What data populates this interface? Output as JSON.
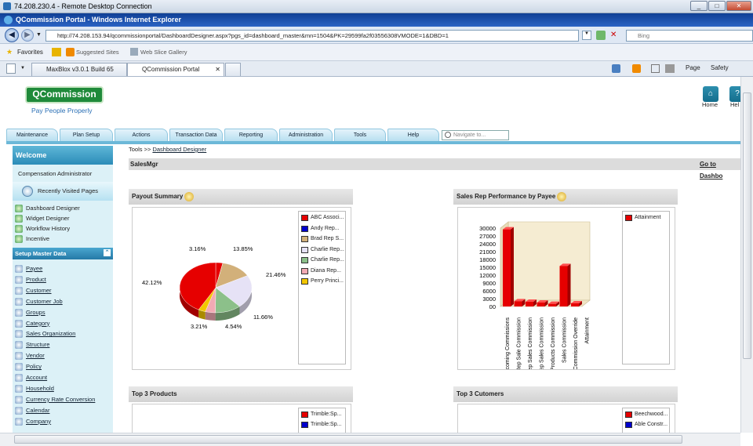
{
  "rdp": {
    "title": "74.208.230.4 - Remote Desktop Connection"
  },
  "ie": {
    "title": "QCommission Portal - Windows Internet Explorer",
    "url": "http://74.208.153.94/qcommissionportal/DashboardDesigner.aspx?pgs_id=dashboard_master&mn=1504&PK=29599fa2f03556308VMODE=1&DBD=1",
    "search_placeholder": "Bing",
    "favorites": "Favorites",
    "suggested": "Suggested Sites",
    "webslice": "Web Slice Gallery",
    "tabs": [
      "MaxBlox v3.0.1 Build 65",
      "QCommission Portal"
    ],
    "cmd_page": "Page",
    "cmd_safety": "Safety"
  },
  "app": {
    "logo": "QCommission",
    "tagline": "Pay People Properly",
    "home": "Home",
    "help": "Hel",
    "nav": [
      "Maintenance",
      "Plan Setup",
      "Actions",
      "Transaction Data",
      "Reporting",
      "Administration",
      "Tools",
      "Help"
    ],
    "navigate_placeholder": "Navigate to..."
  },
  "sidebar": {
    "welcome": "Welcome",
    "role": "Compensation Administrator",
    "recent": "Recently Visited Pages",
    "recent_items": [
      "Dashboard Designer",
      "Widget Designer",
      "Workflow History",
      "Incentive"
    ],
    "setup_title": "Setup Master Data",
    "setup_items": [
      "Payee",
      "Product",
      "Customer",
      "Customer Job",
      "Groups",
      "Category",
      "Sales Organization",
      "Structure",
      "Vendor",
      "Policy",
      "Account",
      "Household",
      "Currency Rate Conversion",
      "Calendar",
      "Company"
    ]
  },
  "content": {
    "crumb_prefix": "Tools >> ",
    "crumb_link": "Dashboard Designer",
    "section": "SalesMgr",
    "goto": "Go to Dashbo"
  },
  "widgets": {
    "payout": "Payout Summary",
    "salesrep": "Sales Rep Performance by Payee",
    "products": "Top 3 Products",
    "customers": "Top 3 Cutomers"
  },
  "pie": {
    "slices": [
      {
        "name": "ABC  Associ...",
        "pct": 3.16,
        "label": "3.16%",
        "color": "#e60000"
      },
      {
        "name": "Andy  Rep...",
        "pct": 0.01,
        "label": "",
        "color": "#0000cc"
      },
      {
        "name": "Brad  Rep S...",
        "pct": 13.85,
        "label": "13.85%",
        "color": "#d2b07a"
      },
      {
        "name": "Charlie  Rep...",
        "pct": 21.46,
        "label": "21.46%",
        "color": "#e6e2f6"
      },
      {
        "name": "Charlie  Rep...",
        "pct": 11.66,
        "label": "11.66%",
        "color": "#8cc08a"
      },
      {
        "name": "Diana  Rep...",
        "pct": 4.54,
        "label": "4.54%",
        "color": "#f2aab4"
      },
      {
        "name": "Perry  Princi...",
        "pct": 3.21,
        "label": "3.21%",
        "color": "#f2c600"
      },
      {
        "name": "ABC  Associ...",
        "pct": 42.12,
        "label": "42.12%",
        "color": "#e60000"
      }
    ]
  },
  "chart_data": {
    "type": "bar",
    "title": "Sales Rep Performance by Payee",
    "categories": [
      "Incoming Commissions",
      "Rep Sale Commission",
      "Rep Sales Commission",
      "Rep Sales Commission",
      "Products Commission",
      "Sales Commission",
      "Commission Override",
      "Attainment"
    ],
    "series": [
      {
        "name": "Attainment",
        "values": [
          29500,
          2000,
          1800,
          1500,
          1000,
          15500,
          1200,
          0
        ],
        "color": "#e60000"
      }
    ],
    "yticks": [
      "30000",
      "27000",
      "24000",
      "21000",
      "18000",
      "15000",
      "12000",
      "9000",
      "6000",
      "3000",
      "00"
    ],
    "ylim": [
      0,
      30000
    ],
    "grid": false,
    "legend": "right"
  },
  "products_legend": [
    "Trimble:Sp...",
    "Trimble:Sp..."
  ],
  "customers_legend": [
    "Beechwood...",
    "Able  Constr..."
  ],
  "colors": {
    "red": "#e60000",
    "blue": "#0000cc"
  }
}
